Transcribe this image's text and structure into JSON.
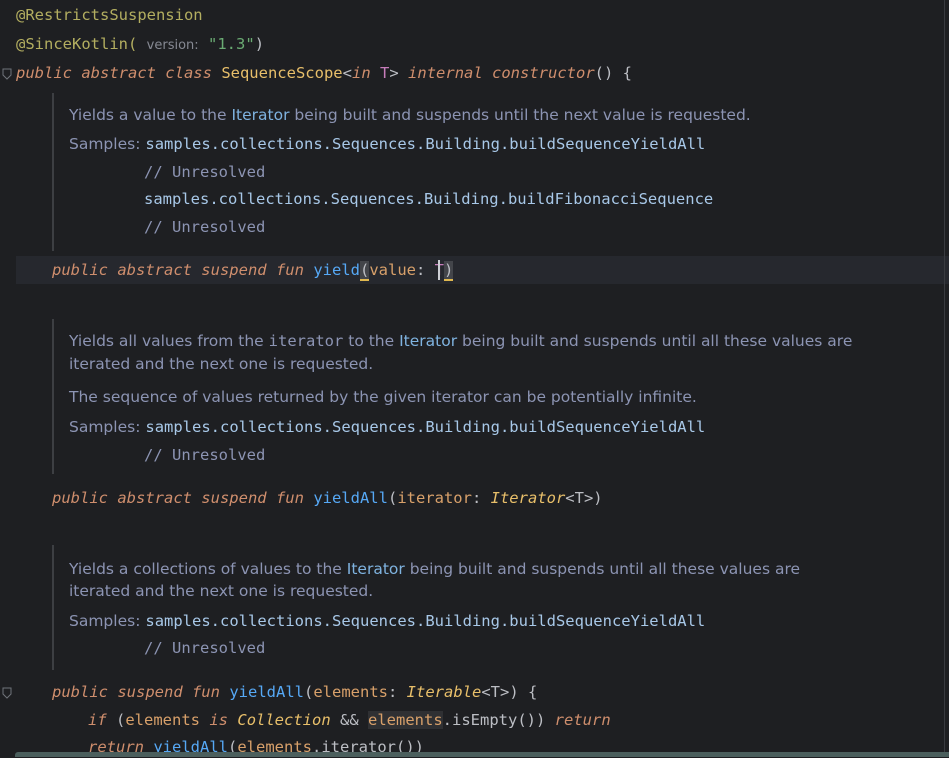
{
  "code": {
    "annotation1": "@RestrictsSuspension",
    "annotation2_name": "@SinceKotlin(",
    "annotation2_hint": "version:",
    "annotation2_value": "\"1.3\"",
    "annotation2_close": ")",
    "class_decl": {
      "kw1": "public abstract class",
      "name": "SequenceScope",
      "lt": "<",
      "in_kw": "in",
      "tparam": "T",
      "gt": ">",
      "kw2": "internal constructor",
      "rest": "() {"
    },
    "yield_decl": {
      "kw": "public abstract suspend fun",
      "name": "yield",
      "open": "(",
      "param": "value",
      "colon": ": ",
      "type": "T",
      "close": ")"
    },
    "yieldall_iter_decl": {
      "kw": "public abstract suspend fun",
      "name": "yieldAll",
      "open": "(",
      "param": "iterator",
      "colon": ": ",
      "type": "Iterator",
      "generic": "<T>",
      "close": ")"
    },
    "yieldall_elem_decl": {
      "kw": "public suspend fun",
      "name": "yieldAll",
      "open": "(",
      "param": "elements",
      "colon": ": ",
      "type": "Iterable",
      "generic": "<T>",
      "close": ") {"
    },
    "if_line": {
      "kw": "if",
      "open": " (",
      "ref1": "elements",
      "is_kw": "is",
      "type": "Collection",
      "and": " && ",
      "ref2": "elements",
      "call": ".isEmpty()",
      "close": ") ",
      "ret": "return"
    },
    "return_line": {
      "kw": "return",
      "name": "yieldAll",
      "open": "(",
      "ref": "elements",
      "call": ".iterator())"
    }
  },
  "docs": {
    "yield": {
      "line1_a": "Yields a value to the ",
      "line1_link": "Iterator",
      "line1_b": " being built and suspends until the next value is requested.",
      "samples_label": "Samples:",
      "sample1": "samples.collections.Sequences.Building.buildSequenceYieldAll",
      "unres1": "// Unresolved",
      "sample2": "samples.collections.Sequences.Building.buildFibonacciSequence",
      "unres2": "// Unresolved"
    },
    "yieldall_iter": {
      "line1_a": "Yields all values from the ",
      "line1_mono": "iterator",
      "line1_b": " to the ",
      "line1_link": "Iterator",
      "line1_c": " being built and suspends until all these values are",
      "line2": "iterated and the next one is requested.",
      "line3": "The sequence of values returned by the given iterator can be potentially infinite.",
      "samples_label": "Samples:",
      "sample1": "samples.collections.Sequences.Building.buildSequenceYieldAll",
      "unres1": "// Unresolved"
    },
    "yieldall_elem": {
      "line1_a": "Yields a collections of values to the ",
      "line1_link": "Iterator",
      "line1_b": " being built and suspends until all these values are",
      "line2": "iterated and the next one is requested.",
      "samples_label": "Samples:",
      "sample1": "samples.collections.Sequences.Building.buildSequenceYieldAll",
      "unres1": "// Unresolved"
    }
  },
  "icons": [
    "fold-marker-icon"
  ]
}
